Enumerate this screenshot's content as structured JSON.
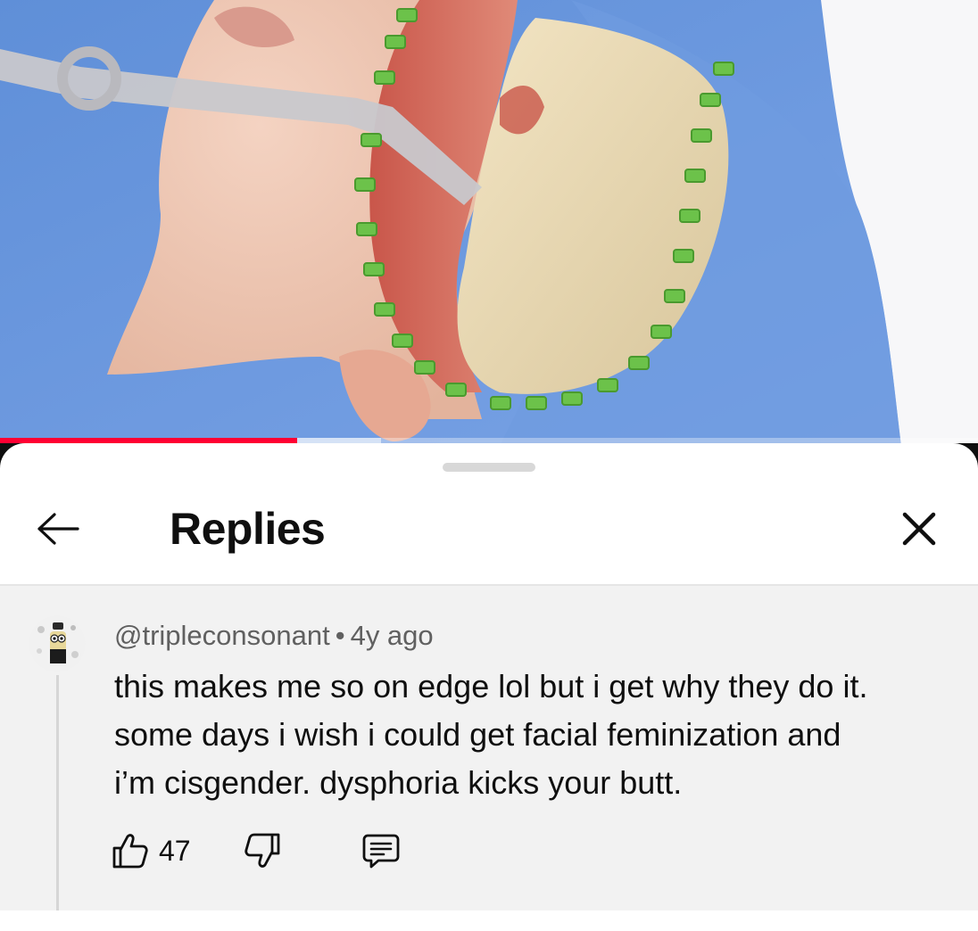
{
  "video": {
    "progress_played_fraction": 0.304,
    "progress_buffered_fraction": 0.39
  },
  "sheet": {
    "title": "Replies",
    "back_icon": "arrow-left-icon",
    "close_icon": "close-icon"
  },
  "comment": {
    "author": "@tripleconsonant",
    "separator": "•",
    "age": "4y ago",
    "text": "this makes me  so on edge lol but i get why they do it.\nsome days i wish i could get facial feminization and\ni’m cisgender. dysphoria kicks your butt.",
    "likes": "47",
    "icons": {
      "like": "thumbs-up-icon",
      "dislike": "thumbs-down-icon",
      "reply": "reply-comment-icon"
    }
  },
  "colors": {
    "progress_played": "#ff0033",
    "sheet_background": "#ffffff",
    "comment_background": "#f2f2f2",
    "text_primary": "#0f0f0f",
    "text_secondary": "#606060"
  }
}
